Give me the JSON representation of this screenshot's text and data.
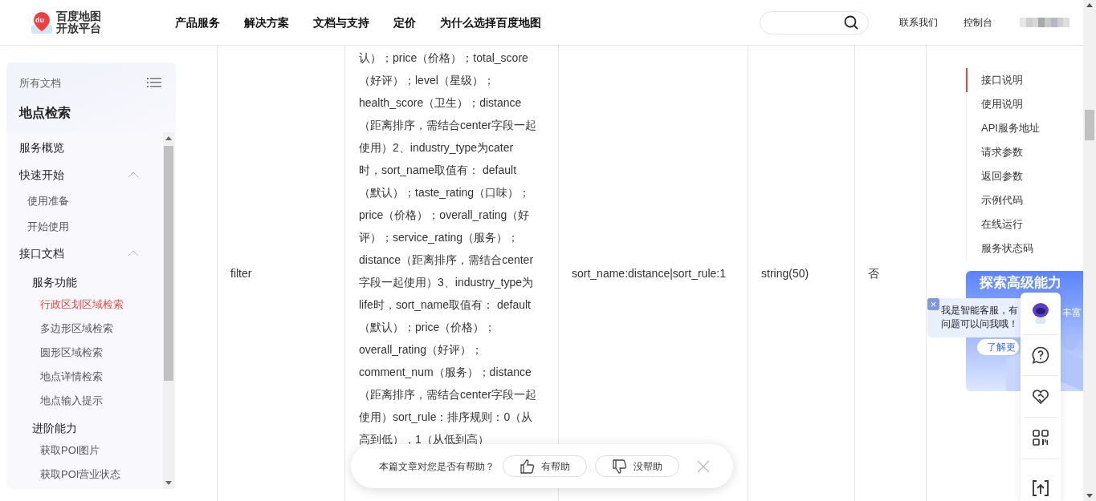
{
  "header": {
    "logo": {
      "line1": "百度地图",
      "line2": "开放平台",
      "mark": "du"
    },
    "nav": [
      "产品服务",
      "解决方案",
      "文档与支持",
      "定价",
      "为什么选择百度地图"
    ],
    "links": [
      "联系我们",
      "控制台"
    ]
  },
  "sidebar": {
    "all_docs": "所有文档",
    "title": "地点检索",
    "items": [
      {
        "label": "服务概览"
      },
      {
        "label": "快速开始",
        "expanded": true,
        "children": [
          {
            "label": "使用准备",
            "selected": false
          },
          {
            "label": "开始使用",
            "selected": false
          }
        ]
      },
      {
        "label": "接口文档",
        "expanded": true,
        "children": [
          {
            "label": "服务功能",
            "children": [
              {
                "label": "行政区划区域检索",
                "selected": true
              },
              {
                "label": "多边形区域检索",
                "selected": false
              },
              {
                "label": "圆形区域检索",
                "selected": false
              },
              {
                "label": "地点详情检索",
                "selected": false
              },
              {
                "label": "地点输入提示",
                "selected": false
              }
            ]
          },
          {
            "label": "进阶能力",
            "children": [
              {
                "label": "获取POI图片",
                "selected": false
              },
              {
                "label": "获取POI营业状态",
                "selected": false
              }
            ]
          }
        ]
      }
    ]
  },
  "table": {
    "row": {
      "name": "filter",
      "description_lines": [
        "认）；price（价格）；total_score",
        "（好评）；level（星级）；",
        "health_score（卫生）；distance",
        "（距离排序，需结合center字段一起",
        "使用）2、industry_type为cater",
        "时，sort_name取值有： default",
        "（默认）；taste_rating（口味）；",
        "price（价格）；overall_rating（好",
        "评）；service_rating（服务）；",
        "distance（距离排序，需结合center",
        "字段一起使用）3、industry_type为",
        "life时，sort_name取值有： default",
        "（默认）；price（价格）；",
        "overall_rating（好评）；",
        "comment_num（服务）；distance",
        "（距离排序，需结合center字段一起",
        "使用）sort_rule：排序规则：0（从",
        "高到低），1（从低到高）"
      ],
      "example": "sort_name:distance|sort_rule:1",
      "type": "string(50)",
      "required": "否"
    }
  },
  "toc": [
    {
      "label": "接口说明",
      "selected": true
    },
    {
      "label": "使用说明",
      "selected": false
    },
    {
      "label": "API服务地址",
      "selected": false
    },
    {
      "label": "请求参数",
      "selected": false
    },
    {
      "label": "返回参数",
      "selected": false
    },
    {
      "label": "示例代码",
      "selected": false
    },
    {
      "label": "在线运行",
      "selected": false
    },
    {
      "label": "服务状态码",
      "selected": false
    }
  ],
  "promo": {
    "title": "探索高级能力",
    "subtitle": "丰富",
    "button": "了解更"
  },
  "chat_bubble": {
    "text": "我是智能客服，有问题可以问我哦！",
    "close": "×"
  },
  "feedback": {
    "question": "本篇文章对您是否有帮助？",
    "buttons": [
      "有帮助",
      "没帮助"
    ]
  }
}
